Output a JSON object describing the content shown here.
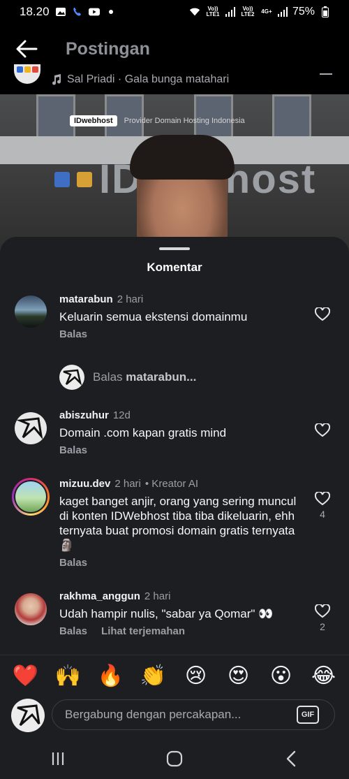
{
  "status_bar": {
    "time": "18.20",
    "sim1_label": "Vo)) LTE1",
    "sim2_label": "Vo)) LTE2",
    "network": "4G+",
    "battery": "75%"
  },
  "header": {
    "title": "Postingan"
  },
  "post": {
    "music_label": "Sal Priadi · Gala bunga matahari",
    "media": {
      "brand_logo_text": "IDwebhost",
      "brand_tagline": "Provider Domain Hosting Indonesia",
      "sign_text": "IDwebhost"
    }
  },
  "comments_sheet": {
    "title": "Komentar",
    "comments": [
      {
        "username": "matarabun",
        "time": "2 hari",
        "text": "Keluarin semua ekstensi domainmu",
        "reply_label": "Balas"
      },
      {
        "username": "abiszuhur",
        "time": "12d",
        "text": "Domain .com kapan gratis mind",
        "reply_label": "Balas"
      },
      {
        "username": "mizuu.dev",
        "time": "2 hari",
        "meta": "• Kreator AI",
        "text": "kaget banget anjir, orang yang sering muncul di konten IDWebhost tiba tiba dikeluarin, ehh ternyata buat promosi domain gratis ternyata🗿",
        "reply_label": "Balas",
        "likes": "4"
      },
      {
        "username": "rakhma_anggun",
        "time": "2 hari",
        "text": "Udah hampir nulis, \"sabar ya Qomar\" 👀",
        "reply_label": "Balas",
        "translate_label": "Lihat terjemahan",
        "likes": "2"
      }
    ],
    "reply_prompt": {
      "prefix": "Balas ",
      "username": "matarabun..."
    },
    "quick_emojis": [
      "❤️",
      "🙌",
      "🔥",
      "👏",
      "😢",
      "😍",
      "😮",
      "😂"
    ],
    "input": {
      "placeholder": "Bergabung dengan percakapan...",
      "gif_label": "GIF"
    }
  },
  "colors": {
    "sheet_bg": "#1c1e22",
    "text_primary": "#f2f3f5",
    "text_secondary": "#9b9ea4"
  },
  "icons": {
    "back": "arrow-left-icon",
    "music": "music-note-icon",
    "like": "heart-outline-icon",
    "nav_recents": "recent-apps-icon",
    "nav_home": "home-icon",
    "nav_back": "nav-back-icon"
  }
}
